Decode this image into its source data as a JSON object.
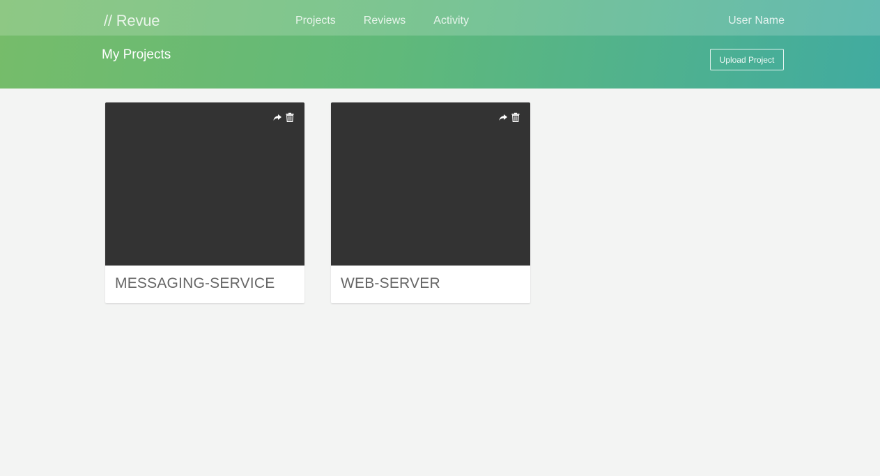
{
  "header": {
    "brand": "// Revue",
    "nav": [
      {
        "label": "Projects"
      },
      {
        "label": "Reviews"
      },
      {
        "label": "Activity"
      }
    ],
    "user_name": "User Name",
    "page_title": "My Projects",
    "upload_label": "Upload Project"
  },
  "projects": [
    {
      "name": "MESSAGING-SERVICE",
      "actions": [
        "share-icon",
        "trash-icon"
      ]
    },
    {
      "name": "WEB-SERVER",
      "actions": [
        "share-icon",
        "trash-icon"
      ]
    }
  ],
  "colors": {
    "header_gradient_start": "#76bc6a",
    "header_gradient_end": "#41aba0",
    "page_background": "#f3f4f3",
    "card_thumbnail": "#333333",
    "card_title": "#666666"
  }
}
